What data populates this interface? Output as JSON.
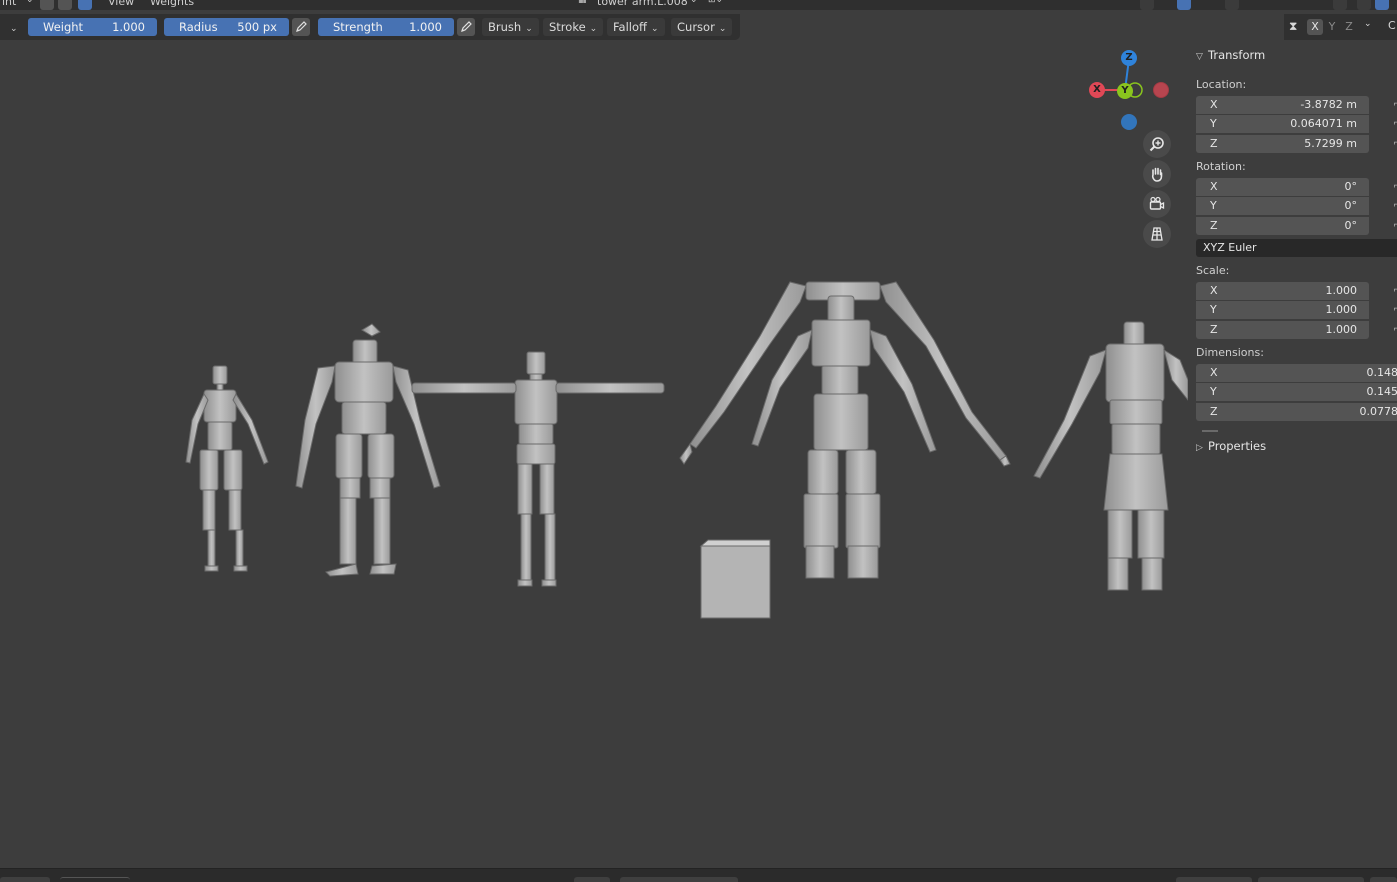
{
  "header": {
    "mode_fragment": "int",
    "menu": [
      "View",
      "Weights"
    ],
    "active_object": "tower arm.L.008"
  },
  "toolbar": {
    "weight": {
      "label": "Weight",
      "value": "1.000"
    },
    "radius": {
      "label": "Radius",
      "value": "500 px"
    },
    "strength": {
      "label": "Strength",
      "value": "1.000"
    },
    "menus": [
      "Brush",
      "Stroke",
      "Falloff",
      "Cursor"
    ],
    "mirror_axes": [
      "X",
      "Y",
      "Z"
    ]
  },
  "gizmo": {
    "x": "X",
    "y": "Y",
    "z": "Z"
  },
  "colors": {
    "accent": "#4772b3",
    "axis_x": "#e04856",
    "axis_y": "#8ac51e",
    "axis_z": "#2f83db",
    "viewport_bg": "#3d3d3d"
  },
  "npanel": {
    "transform_title": "Transform",
    "location_label": "Location:",
    "location": [
      {
        "axis": "X",
        "value": "-3.8782 m"
      },
      {
        "axis": "Y",
        "value": "0.064071 m"
      },
      {
        "axis": "Z",
        "value": "5.7299 m"
      }
    ],
    "rotation_label": "Rotation:",
    "rotation": [
      {
        "axis": "X",
        "value": "0°"
      },
      {
        "axis": "Y",
        "value": "0°"
      },
      {
        "axis": "Z",
        "value": "0°"
      }
    ],
    "rotation_mode": "XYZ Euler",
    "scale_label": "Scale:",
    "scale": [
      {
        "axis": "X",
        "value": "1.000"
      },
      {
        "axis": "Y",
        "value": "1.000"
      },
      {
        "axis": "Z",
        "value": "1.000"
      }
    ],
    "dimensions_label": "Dimensions:",
    "dimensions": [
      {
        "axis": "X",
        "value": "0.148"
      },
      {
        "axis": "Y",
        "value": "0.145"
      },
      {
        "axis": "Z",
        "value": "0.0778"
      }
    ],
    "properties_title": "Properties"
  },
  "icons": {
    "zoom": "zoom-icon",
    "pan": "hand-icon",
    "camera": "camera-icon",
    "ortho": "grid-perspective-icon"
  }
}
